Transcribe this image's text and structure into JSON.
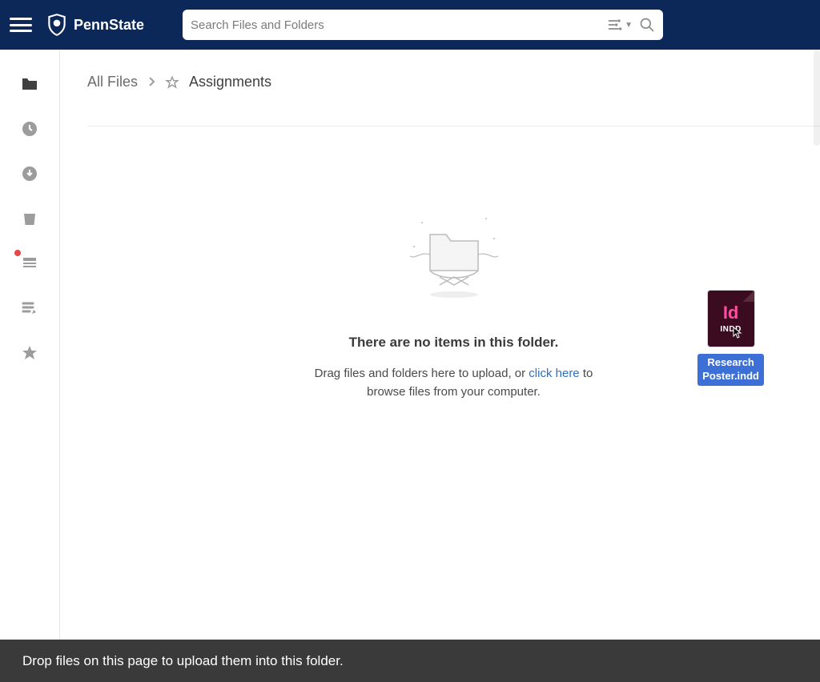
{
  "brand": {
    "name": "PennState"
  },
  "search": {
    "placeholder": "Search Files and Folders"
  },
  "sidebar": {
    "items": [
      {
        "name": "files-icon",
        "active": true
      },
      {
        "name": "recents-icon"
      },
      {
        "name": "downloads-icon"
      },
      {
        "name": "trash-icon"
      },
      {
        "name": "notifications-icon",
        "dot": true
      },
      {
        "name": "notes-icon"
      },
      {
        "name": "favorites-icon"
      }
    ]
  },
  "breadcrumb": {
    "root": "All Files",
    "current": "Assignments"
  },
  "empty": {
    "title": "There are no items in this folder.",
    "sub_pre": "Drag files and folders here to upload, or ",
    "link": "click here",
    "sub_post": " to browse files from your computer."
  },
  "drag": {
    "big": "Id",
    "ext": "INDD",
    "label_line1": "Research",
    "label_line2": "Poster.indd"
  },
  "footer": {
    "text": "Drop files on this page to upload them into this folder."
  }
}
